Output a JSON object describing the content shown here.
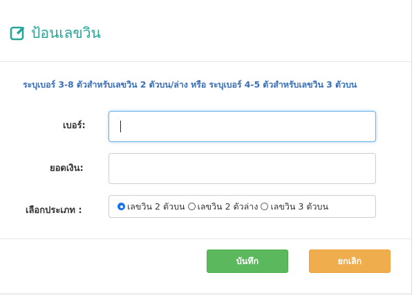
{
  "modal": {
    "title": "ป้อนเลขวิน",
    "title_icon": "edit-icon",
    "hint": "ระบุเบอร์ 3-8 ตัวสำหรับเลขวิน 2 ตัวบน/ล่าง หรือ ระบุเบอร์ 4-5 ตัวสำหรับเลขวิน 3 ตัวบน",
    "accent_color": "#26a69a",
    "hint_color": "#3b6fb6"
  },
  "form": {
    "number_label": "เบอร์:",
    "number_value": "",
    "amount_label": "ยอดเงิน:",
    "amount_value": "",
    "type_label": "เลือกประเภท :",
    "type_options": [
      {
        "label": "เลขวิน 2 ตัวบน",
        "checked": true
      },
      {
        "label": "เลขวิน 2 ตัวล่าง",
        "checked": false
      },
      {
        "label": "เลขวิน 3 ตัวบน",
        "checked": false
      }
    ]
  },
  "footer": {
    "save_label": "บันทึก",
    "save_color": "#5cb85c",
    "cancel_label": "ยกเลิก",
    "cancel_color": "#f0ad4e"
  }
}
